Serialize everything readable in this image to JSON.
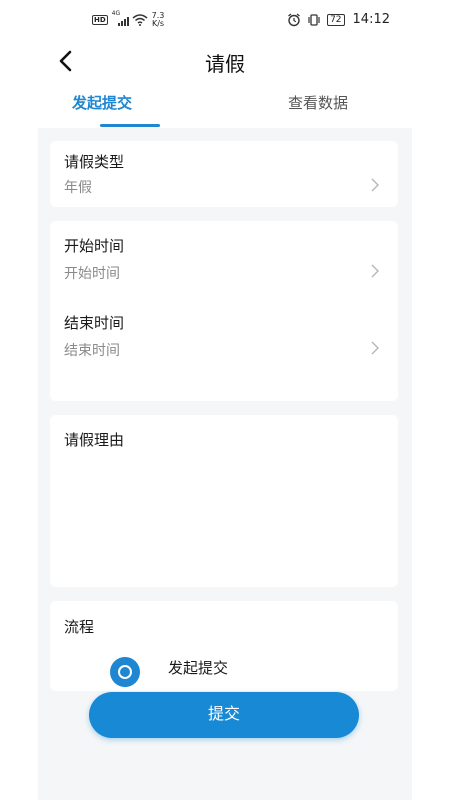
{
  "status_bar": {
    "hd": "HD",
    "network": "4G",
    "speed_value": "7.3",
    "speed_unit": "K/s",
    "battery": "72",
    "time": "14:12"
  },
  "navbar": {
    "title": "请假"
  },
  "tabs": [
    {
      "label": "发起提交",
      "active": true
    },
    {
      "label": "查看数据",
      "active": false
    }
  ],
  "form": {
    "leave_type": {
      "label": "请假类型",
      "value": "年假"
    },
    "start_time": {
      "label": "开始时间",
      "placeholder": "开始时间"
    },
    "end_time": {
      "label": "结束时间",
      "placeholder": "结束时间"
    },
    "reason": {
      "label": "请假理由"
    },
    "flow": {
      "label": "流程",
      "steps": [
        "发起提交"
      ]
    }
  },
  "submit_label": "提交",
  "colors": {
    "accent": "#1f86d1",
    "button": "#1789d5",
    "background": "#f5f6f8"
  }
}
